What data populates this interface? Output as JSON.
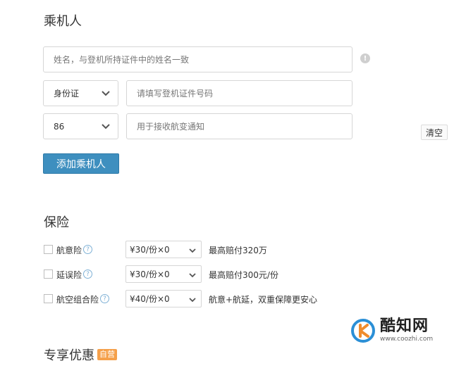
{
  "passenger": {
    "title": "乘机人",
    "name_placeholder": "姓名，与登机所持证件中的姓名一致",
    "id_type": "身份证",
    "id_placeholder": "请填写登机证件号码",
    "country_code": "86",
    "phone_placeholder": "用于接收航变通知",
    "clear_label": "清空",
    "add_label": "添加乘机人",
    "info_icon": "!"
  },
  "insurance": {
    "title": "保险",
    "items": [
      {
        "name": "航意险",
        "option": "¥30/份×0",
        "desc": "最高赔付320万"
      },
      {
        "name": "延误险",
        "option": "¥30/份×0",
        "desc": "最高赔付300元/份"
      },
      {
        "name": "航空组合险",
        "option": "¥40/份×0",
        "desc": "航意+航延，双重保障更安心"
      }
    ]
  },
  "offer": {
    "title": "专享优惠",
    "badge": "自营"
  },
  "watermark": {
    "brand": "酷知网",
    "url": "www.coozhi.com"
  },
  "icons": {
    "help": "question-icon",
    "dropdown": "chevron-down-icon"
  }
}
